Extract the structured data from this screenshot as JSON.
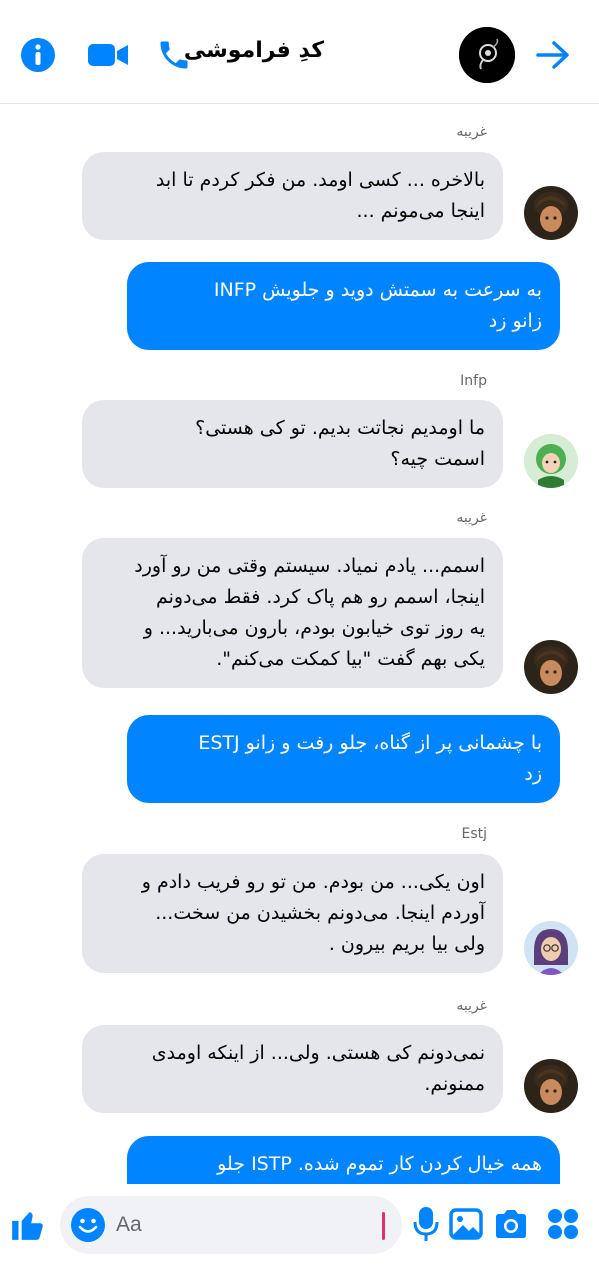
{
  "header": {
    "title": "کدِ فراموشی",
    "accent_color": "#0084ff",
    "icons": [
      "info-icon",
      "video-camera-icon",
      "phone-icon",
      "arrow-right-icon"
    ]
  },
  "messages": [
    {
      "sender": "غریبه",
      "text": "بالاخره ... کسی اومد. من فکر کردم تا ابد\nاینجا می‌مونم ..."
    },
    {
      "text": "به سرعت به سمتش دوید و جلویش INFP\nزانو زد"
    },
    {
      "sender": "Infp",
      "text": "ما اومدیم نجاتت بدیم. تو کی هستی؟\nاسمت چیه؟"
    },
    {
      "sender": "غریبه",
      "text": "اسمم... یادم نمیاد. سیستم وقتی من رو آورد\nاینجا، اسمم رو هم پاک کرد. فقط می‌دونم\nیه روز توی خیابون بودم، بارون می‌بارید... و\nیکی بهم گفت \"بیا کمکت می‌کنم\"."
    },
    {
      "text": "با چشمانی پر از گناه، جلو رفت و زانو ESTJ\nزد"
    },
    {
      "sender": "Estj",
      "text": "اون یکی... من بودم. من تو رو فریب دادم و\nآوردم اینجا. می‌دونم بخشیدن من سخت...\nولی بیا بریم بیرون ."
    },
    {
      "sender": "غریبه",
      "text": "نمی‌دونم کی هستی. ولی... از اینکه اومدی\nممنونم."
    },
    {
      "text": "همه خیال کردن کار تموم شده. ISTP جلو\n"
    }
  ],
  "composer": {
    "placeholder": "Aa",
    "value": "",
    "icons": [
      "like-icon",
      "emoji-icon",
      "microphone-icon",
      "image-icon",
      "camera-icon",
      "apps-icon"
    ]
  }
}
